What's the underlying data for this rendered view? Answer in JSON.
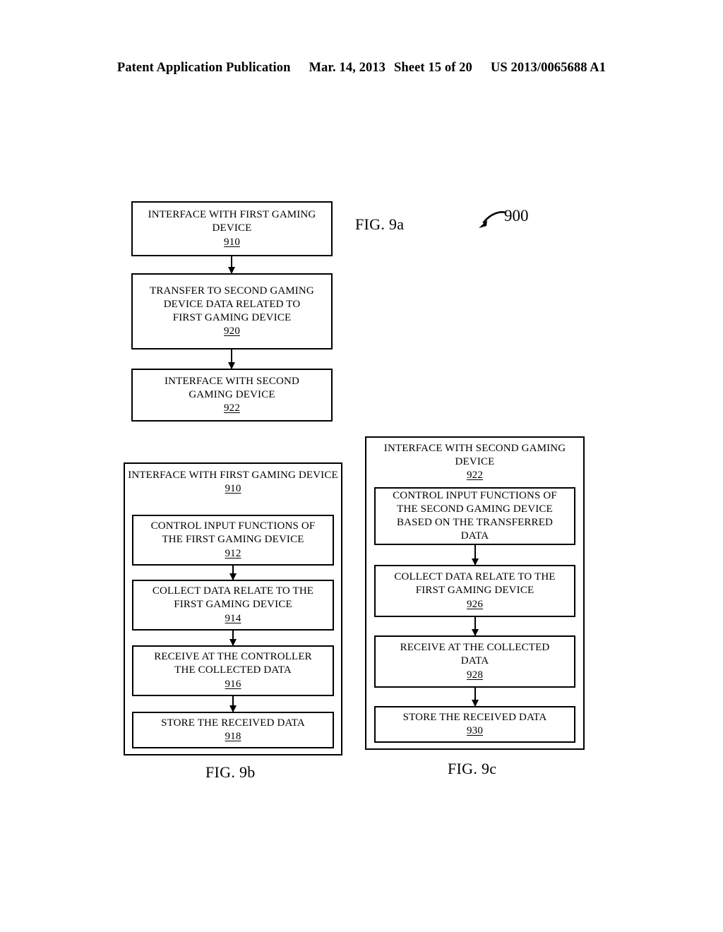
{
  "header": {
    "publication": "Patent Application Publication",
    "date": "Mar. 14, 2013",
    "sheet": "Sheet 15 of 20",
    "patent_number": "US 2013/0065688 A1"
  },
  "fig9a": {
    "caption": "FIG. 9a",
    "lead_reference": "900",
    "boxes": [
      {
        "lines": [
          "INTERFACE WITH FIRST GAMING",
          "DEVICE"
        ],
        "ref": "910"
      },
      {
        "lines": [
          "TRANSFER TO SECOND GAMING",
          "DEVICE DATA RELATED TO",
          "FIRST GAMING DEVICE"
        ],
        "ref": "920"
      },
      {
        "lines": [
          "INTERFACE WITH SECOND",
          "GAMING DEVICE"
        ],
        "ref": "922"
      }
    ]
  },
  "fig9b": {
    "caption": "FIG. 9b",
    "title_lines": [
      "INTERFACE WITH FIRST GAMING",
      "DEVICE"
    ],
    "title_ref": "910",
    "boxes": [
      {
        "lines": [
          "CONTROL INPUT FUNCTIONS OF",
          "THE FIRST GAMING DEVICE"
        ],
        "ref": "912"
      },
      {
        "lines": [
          "COLLECT DATA RELATE TO THE",
          "FIRST GAMING DEVICE"
        ],
        "ref": "914"
      },
      {
        "lines": [
          "RECEIVE AT THE CONTROLLER",
          "THE COLLECTED DATA"
        ],
        "ref": "916"
      },
      {
        "lines": [
          "STORE THE RECEIVED DATA"
        ],
        "ref": "918"
      }
    ]
  },
  "fig9c": {
    "caption": "FIG. 9c",
    "title_lines": [
      "INTERFACE WITH SECOND GAMING",
      "DEVICE"
    ],
    "title_ref": "922",
    "boxes": [
      {
        "lines": [
          "CONTROL INPUT FUNCTIONS OF",
          "THE SECOND GAMING DEVICE",
          "BASED ON THE TRANSFERRED",
          "DATA"
        ],
        "ref": ""
      },
      {
        "lines": [
          "COLLECT DATA RELATE TO THE",
          "FIRST GAMING DEVICE"
        ],
        "ref": "926"
      },
      {
        "lines": [
          "RECEIVE AT THE COLLECTED",
          "DATA"
        ],
        "ref": "928"
      },
      {
        "lines": [
          "STORE THE RECEIVED DATA"
        ],
        "ref": "930"
      }
    ]
  }
}
